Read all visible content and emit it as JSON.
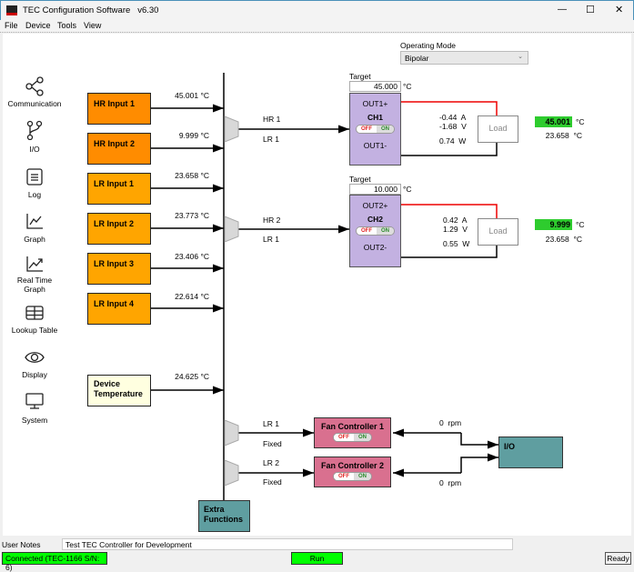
{
  "window": {
    "title": "TEC Configuration Software   v6.30",
    "controls": [
      "—",
      "☐",
      "✕"
    ]
  },
  "menu": [
    "File",
    "Device",
    "Tools",
    "View"
  ],
  "sidebar": [
    {
      "label": "Communication",
      "icon": "share-icon"
    },
    {
      "label": "I/O",
      "icon": "branch-icon"
    },
    {
      "label": "Log",
      "icon": "log-icon"
    },
    {
      "label": "Graph",
      "icon": "graph-icon"
    },
    {
      "label": "Real Time Graph",
      "icon": "realtime-graph-icon"
    },
    {
      "label": "Lookup Table",
      "icon": "table-icon"
    },
    {
      "label": "Display",
      "icon": "eye-icon"
    },
    {
      "label": "System",
      "icon": "monitor-icon"
    }
  ],
  "operating_mode": {
    "label": "Operating Mode",
    "value": "Bipolar"
  },
  "inputs": [
    {
      "label": "HR Input 1",
      "value": "45.001  °C"
    },
    {
      "label": "HR Input 2",
      "value": "9.999  °C"
    },
    {
      "label": "LR Input 1",
      "value": "23.658  °C"
    },
    {
      "label": "LR Input 2",
      "value": "23.773  °C"
    },
    {
      "label": "LR Input 3",
      "value": "23.406  °C"
    },
    {
      "label": "LR Input 4",
      "value": "22.614  °C"
    },
    {
      "label": "Device Temperature",
      "value": "24.625  °C"
    }
  ],
  "channels": [
    {
      "target_label": "Target",
      "target": "45.000",
      "unit": "°C",
      "mux_hr": "HR 1",
      "mux_lr": "LR 1",
      "out_plus": "OUT1+",
      "name": "CH1",
      "out_minus": "OUT1-",
      "off": "OFF",
      "on": "ON",
      "current": "-0.44  A",
      "voltage": "-1.68  V",
      "power": "0.74  W",
      "load": "Load",
      "object_temp": "45.001",
      "sink_temp": "23.658  °C"
    },
    {
      "target_label": "Target",
      "target": "10.000",
      "unit": "°C",
      "mux_hr": "HR 2",
      "mux_lr": "LR 1",
      "out_plus": "OUT2+",
      "name": "CH2",
      "out_minus": "OUT2-",
      "off": "OFF",
      "on": "ON",
      "current": "0.42  A",
      "voltage": "1.29  V",
      "power": "0.55  W",
      "load": "Load",
      "object_temp": "9.999",
      "sink_temp": "23.658  °C"
    }
  ],
  "fans": [
    {
      "name": "Fan Controller 1",
      "mux_top": "LR 1",
      "mux_bottom": "Fixed",
      "rpm": "0  rpm",
      "off": "OFF",
      "on": "ON"
    },
    {
      "name": "Fan Controller 2",
      "mux_top": "LR 2",
      "mux_bottom": "Fixed",
      "rpm": "0  rpm",
      "off": "OFF",
      "on": "ON"
    }
  ],
  "io_label": "I/O",
  "extra_functions": "Extra Functions",
  "notes": {
    "label": "User Notes",
    "value": "Test TEC Controller for Development"
  },
  "status": {
    "connection": "Connected (TEC-1166 S/N: 6)",
    "run": "Run",
    "ready": "Ready"
  },
  "colors": {
    "hr_input": "#ff8c00",
    "lr_input": "#ffa500",
    "channel": "#c3b1e1",
    "fan": "#d9708f",
    "teal": "#5f9ea0",
    "ok_green": "#2ecc2e",
    "status_green": "#00ff00"
  }
}
